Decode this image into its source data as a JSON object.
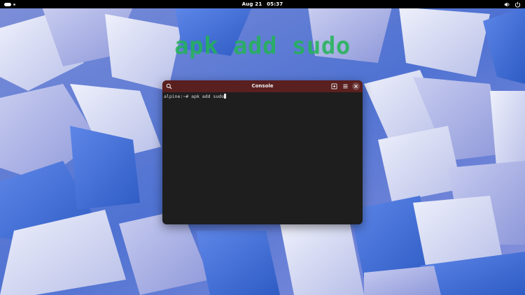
{
  "topbar": {
    "date": "Aug 21",
    "time": "05:37",
    "icons": [
      "activities-indicator",
      "sound-icon",
      "power-icon"
    ]
  },
  "overlay": {
    "text": "apk add sudo",
    "color": "#22b455"
  },
  "window": {
    "title": "Console",
    "titlebar_color": "#5a1f1f",
    "background_color": "#1e1e1e",
    "buttons": [
      "search-icon",
      "new-tab-icon",
      "menu-icon",
      "close-icon"
    ]
  },
  "terminal": {
    "prompt": "alpine:~#",
    "command": "apk add sudo"
  }
}
